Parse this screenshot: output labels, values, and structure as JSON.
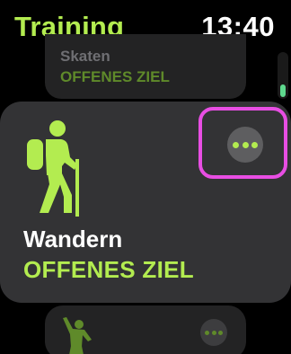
{
  "header": {
    "title": "Training",
    "time": "13:40"
  },
  "workouts": [
    {
      "name": "Skaten",
      "goal": "OFFENES ZIEL",
      "icon": "skating-icon"
    },
    {
      "name": "Wandern",
      "goal": "OFFENES ZIEL",
      "icon": "hiking-icon",
      "more_icon": "ellipsis-icon"
    },
    {
      "name": "",
      "goal": "",
      "icon": "dance-icon",
      "more_icon": "ellipsis-icon"
    }
  ],
  "colors": {
    "accent": "#b3ec50",
    "card": "#333335",
    "highlight": "#e84ee3",
    "scroll_thumb": "#5fd98e"
  }
}
